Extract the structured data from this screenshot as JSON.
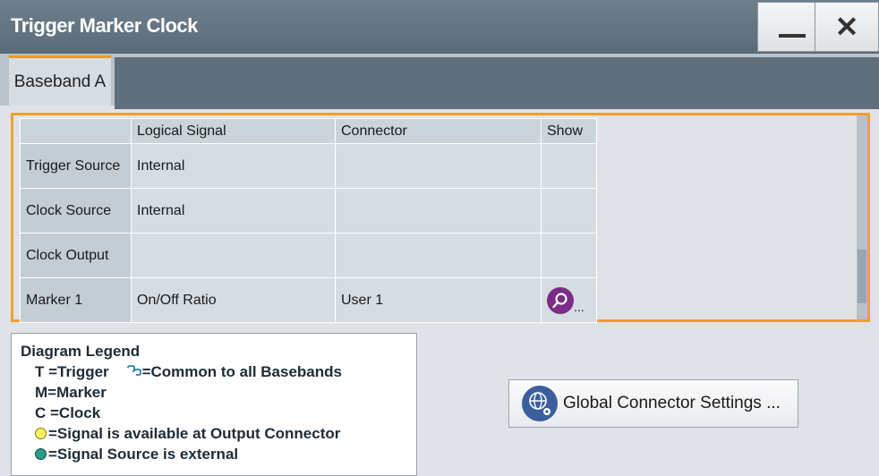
{
  "window": {
    "title": "Trigger Marker Clock",
    "minimize_label": "minimize",
    "close_label": "close"
  },
  "tabs": [
    {
      "label": "Baseband A",
      "active": true
    }
  ],
  "table": {
    "headers": [
      "",
      "Logical Signal",
      "Connector",
      "Show"
    ],
    "rows": [
      {
        "name": "Trigger Source",
        "signal": "Internal",
        "connector": "",
        "show": ""
      },
      {
        "name": "Clock Source",
        "signal": "Internal",
        "connector": "",
        "show": ""
      },
      {
        "name": "Clock Output",
        "signal": "",
        "connector": "",
        "show": ""
      },
      {
        "name": "Marker 1",
        "signal": "On/Off Ratio",
        "connector": "User 1",
        "show": "..."
      }
    ]
  },
  "legend": {
    "title": "Diagram Legend",
    "trigger": "T =Trigger",
    "common": "=Common to all Basebands",
    "marker": "M=Marker",
    "clock": "C =Clock",
    "output": "=Signal is available at Output Connector",
    "external": "=Signal Source is external"
  },
  "global_button": {
    "label": "Global Connector Settings ..."
  },
  "colors": {
    "accent": "#f0a030",
    "show_button": "#7a2d87",
    "titlebar": "#5b6b78"
  }
}
